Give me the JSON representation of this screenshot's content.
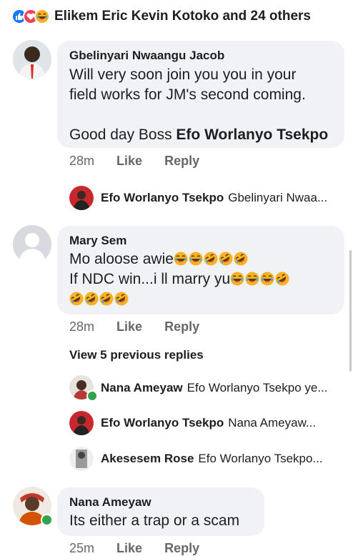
{
  "reactions": {
    "icons": [
      "like-icon",
      "love-icon",
      "haha-icon"
    ],
    "summary": "Elikem Eric Kevin Kotoko and 24 others"
  },
  "comments": [
    {
      "author": "Gbelinyari Nwaangu Jacob",
      "line1": "Will very soon join you you in your",
      "line2": "field works for JM's second coming.",
      "line3_prefix": "Good day Boss ",
      "line3_tag": "Efo Worlanyo Tsekpo",
      "time": "28m",
      "like": "Like",
      "reply": "Reply"
    },
    {
      "author": "Mary Sem",
      "line1": "Mo aloose awie",
      "line2": "If NDC win...i ll marry yu",
      "time": "28m",
      "like": "Like",
      "reply": "Reply"
    },
    {
      "author": "Nana Ameyaw",
      "line1": "Its either a trap or a scam",
      "time": "25m",
      "like": "Like",
      "reply": "Reply"
    }
  ],
  "reply_preview_1": {
    "author": "Efo Worlanyo Tsekpo",
    "text": "Gbelinyari Nwaa..."
  },
  "view_previous": "View 5 previous replies",
  "replies": [
    {
      "author": "Nana Ameyaw",
      "text": "Efo Worlanyo Tsekpo ye..."
    },
    {
      "author": "Efo Worlanyo Tsekpo",
      "text": "Nana Ameyaw..."
    },
    {
      "author": "Akesesem Rose",
      "text": "Efo Worlanyo Tsekpo..."
    }
  ],
  "colors": {
    "bubble": "#f0f2f5",
    "meta": "#65676b",
    "like_blue": "#1877f2",
    "love_red": "#f33e58",
    "haha_yellow": "#f7b125",
    "online_green": "#31a24c"
  }
}
